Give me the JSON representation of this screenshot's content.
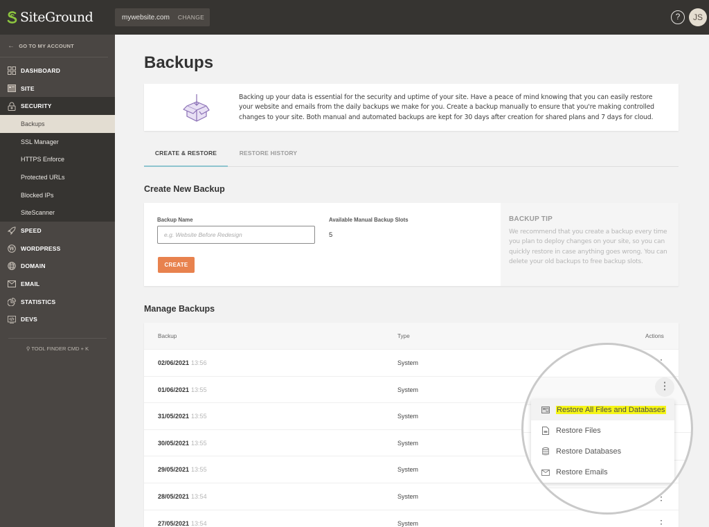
{
  "brand": {
    "name": "SiteGround",
    "accent": "#8dc63f"
  },
  "topbar": {
    "site_name": "mywebsite.com",
    "change_label": "CHANGE",
    "help_label": "?",
    "avatar_initials": "JS"
  },
  "sidebar": {
    "back_label": "GO TO MY ACCOUNT",
    "items": [
      {
        "label": "DASHBOARD",
        "icon": "dashboard-icon"
      },
      {
        "label": "SITE",
        "icon": "site-icon"
      },
      {
        "label": "SECURITY",
        "icon": "lock-icon"
      },
      {
        "label": "SPEED",
        "icon": "rocket-icon"
      },
      {
        "label": "WORDPRESS",
        "icon": "wordpress-icon"
      },
      {
        "label": "DOMAIN",
        "icon": "globe-icon"
      },
      {
        "label": "EMAIL",
        "icon": "envelope-icon"
      },
      {
        "label": "STATISTICS",
        "icon": "pie-chart-icon"
      },
      {
        "label": "DEVS",
        "icon": "code-icon"
      }
    ],
    "security_subitems": [
      {
        "label": "Backups",
        "active": true
      },
      {
        "label": "SSL Manager",
        "active": false
      },
      {
        "label": "HTTPS Enforce",
        "active": false
      },
      {
        "label": "Protected URLs",
        "active": false
      },
      {
        "label": "Blocked IPs",
        "active": false
      },
      {
        "label": "SiteScanner",
        "active": false
      }
    ],
    "tool_finder_label": "TOOL FINDER CMD + K"
  },
  "page": {
    "title": "Backups",
    "intro_text": "Backing up your data is essential for the security and uptime of your site. Have a peace of mind knowing that you can easily restore your website and emails from the daily backups we make for you. Create a backup manually to ensure that you're making controlled changes to your site. Both manual and automated backups are kept for 30 days after creation for shared plans and 7 days for cloud.",
    "tabs": [
      {
        "label": "CREATE & RESTORE",
        "active": true
      },
      {
        "label": "RESTORE HISTORY",
        "active": false
      }
    ]
  },
  "create_backup": {
    "section_title": "Create New Backup",
    "name_label": "Backup Name",
    "name_placeholder": "e.g. Website Before Redesign",
    "name_value": "",
    "slots_label": "Available Manual Backup Slots",
    "slots_value": "5",
    "create_label": "CREATE",
    "create_color": "#e8824e",
    "tip_title": "BACKUP TIP",
    "tip_text": "We recommend that you create a backup every time you plan to deploy changes on your site, so you can quickly restore in case anything goes wrong. You can delete your old backups to free backup slots."
  },
  "manage_backups": {
    "section_title": "Manage Backups",
    "columns": [
      "Backup",
      "Type",
      "Actions"
    ],
    "rows": [
      {
        "date": "02/06/2021",
        "time": "13:56",
        "type": "System"
      },
      {
        "date": "01/06/2021",
        "time": "13:55",
        "type": "System"
      },
      {
        "date": "31/05/2021",
        "time": "13:55",
        "type": "System"
      },
      {
        "date": "30/05/2021",
        "time": "13:55",
        "type": "System"
      },
      {
        "date": "29/05/2021",
        "time": "13:55",
        "type": "System"
      },
      {
        "date": "28/05/2021",
        "time": "13:54",
        "type": "System"
      },
      {
        "date": "27/05/2021",
        "time": "13:54",
        "type": "System"
      }
    ],
    "actions_menu": [
      {
        "label": "Restore All Files and Databases",
        "icon": "server-icon",
        "highlighted": true
      },
      {
        "label": "Restore Files",
        "icon": "file-icon",
        "highlighted": false
      },
      {
        "label": "Restore Databases",
        "icon": "database-icon",
        "highlighted": false
      },
      {
        "label": "Restore Emails",
        "icon": "envelope-icon",
        "highlighted": false
      }
    ],
    "highlight_color": "#f5f516"
  }
}
